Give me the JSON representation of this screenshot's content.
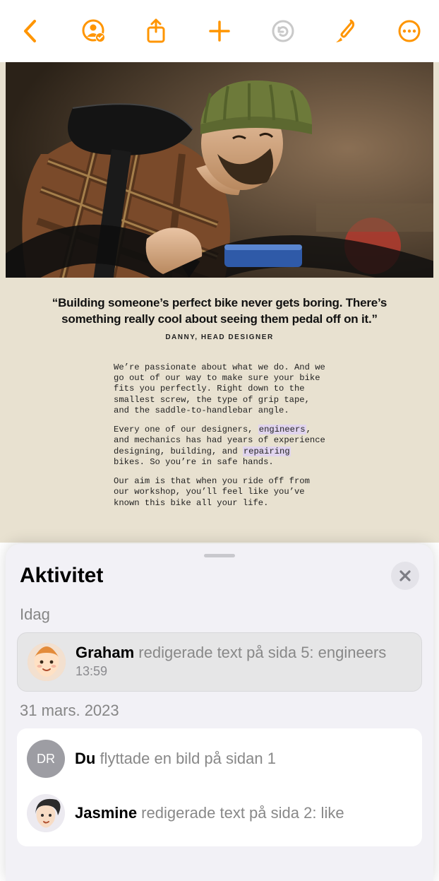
{
  "document": {
    "quote": "“Building someone’s perfect bike never gets boring. There’s something really cool about seeing them pedal off on it.”",
    "attribution": "DANNY, HEAD DESIGNER",
    "p1": "We’re passionate about what we do. And we go out of our way to make sure your bike fits you perfectly. Right down to the smallest screw, the type of grip tape, and the saddle‑to‑handlebar angle.",
    "p2a": "Every one of our designers, ",
    "p2_hl1": "engineers",
    "p2b": ", and mechanics has had years of experience designing, building, and ",
    "p2_hl2": "repairing",
    "p2c": " bikes. So you’re in safe hands.",
    "p3": "Our aim is that when you ride off from our workshop, you’ll feel like you’ve known this bike all your life."
  },
  "sheet": {
    "title": "Aktivitet",
    "sections": [
      {
        "label": "Idag"
      },
      {
        "label": "31 mars. 2023"
      }
    ],
    "items": [
      {
        "who": "Graham",
        "action": " redigerade text på sida 5: engineers",
        "time": "13:59",
        "avatar_initials": "",
        "avatar_bg": "#f9d6b8"
      },
      {
        "who": "Du",
        "action": " flyttade en bild på sidan 1",
        "time": "",
        "avatar_initials": "DR",
        "avatar_bg": "#9d9da3"
      },
      {
        "who": "Jasmine",
        "action": " redigerade text på sida 2: like",
        "time": "",
        "avatar_initials": "",
        "avatar_bg": "#d9d9de"
      }
    ]
  }
}
